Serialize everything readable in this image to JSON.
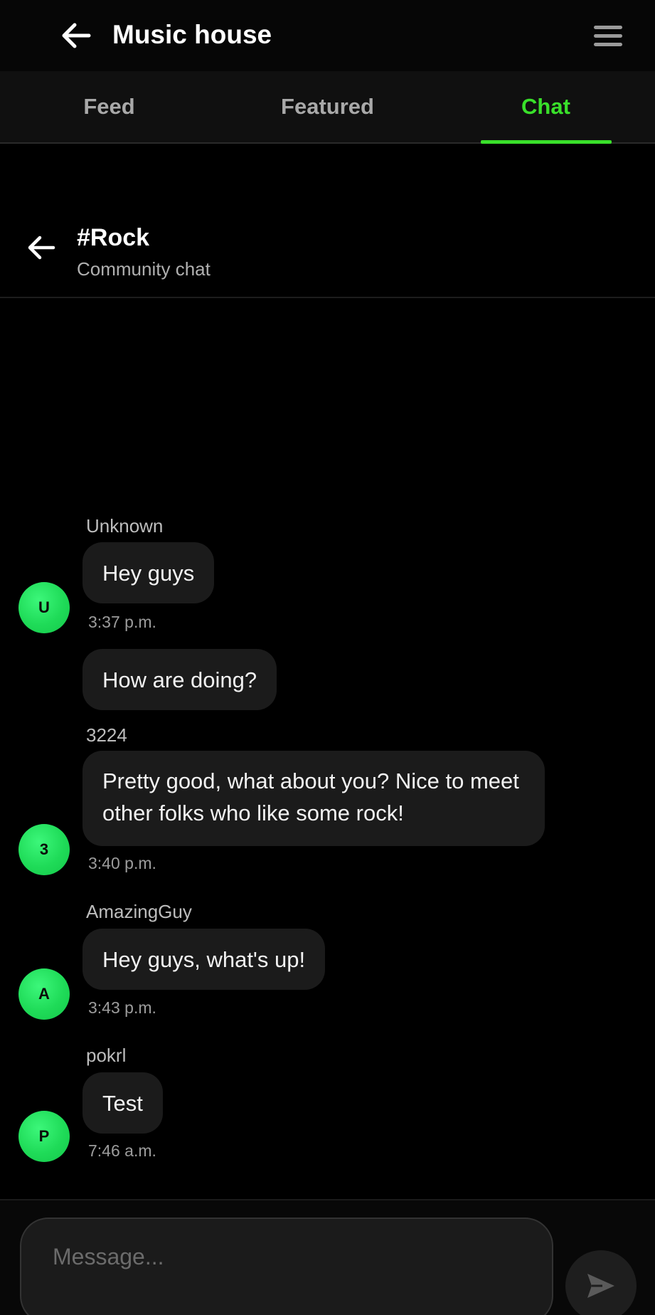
{
  "header": {
    "title": "Music house",
    "back_icon": "arrow-left-icon",
    "menu_icon": "hamburger-menu-icon"
  },
  "tabs": [
    {
      "label": "Feed",
      "active": false
    },
    {
      "label": "Featured",
      "active": false
    },
    {
      "label": "Chat",
      "active": true
    }
  ],
  "channel": {
    "name": "#Rock",
    "subtitle": "Community chat"
  },
  "messages": [
    {
      "author": "Unknown",
      "initial": "U",
      "texts": [
        "Hey guys",
        "How are doing?"
      ],
      "time": "3:37 p.m."
    },
    {
      "author": "3224",
      "initial": "3",
      "texts": [
        "Pretty good, what about you? Nice to meet other folks who like some rock!"
      ],
      "time": "3:40 p.m."
    },
    {
      "author": "AmazingGuy",
      "initial": "A",
      "texts": [
        "Hey guys, what's up!"
      ],
      "time": "3:43 p.m."
    },
    {
      "author": "pokrl",
      "initial": "P",
      "texts": [
        "Test"
      ],
      "time": "7:46 a.m."
    }
  ],
  "composer": {
    "placeholder": "Message...",
    "value": "",
    "send_icon": "send-icon"
  },
  "colors": {
    "accent": "#39e02a",
    "avatar": "#1fdb58",
    "bubble": "#1b1b1b",
    "background": "#000000"
  }
}
